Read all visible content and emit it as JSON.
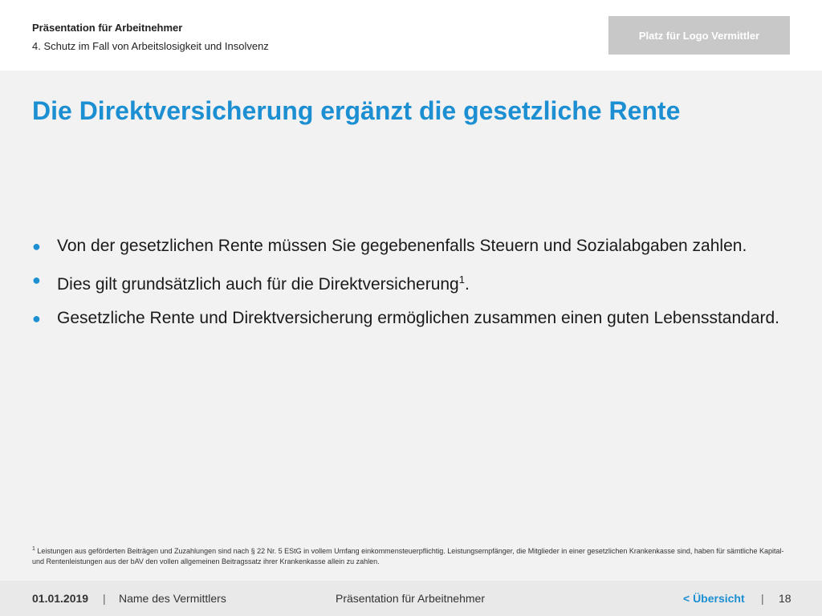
{
  "header": {
    "presentation": "Präsentation für Arbeitnehmer",
    "section": "4. Schutz im Fall von Arbeitslosigkeit und Insolvenz",
    "logo_placeholder": "Platz für Logo Vermittler"
  },
  "slide": {
    "title": "Die Direktversicherung ergänzt die gesetzliche Rente",
    "bullets": [
      {
        "text": "Von der gesetzlichen Rente müssen Sie gegebenenfalls Steuern und Sozialabgaben zahlen."
      },
      {
        "text": "Dies gilt grundsätzlich auch für die Direktversicherung",
        "footnote_ref": "1",
        "tail": "."
      },
      {
        "text": "Gesetzliche Rente und Direktversicherung ermöglichen zusammen einen guten Lebensstandard."
      }
    ],
    "bullet_glyph": "●",
    "footnote": {
      "marker": "1",
      "text": "Leistungen aus geförderten Beiträgen und Zuzahlungen sind nach § 22 Nr. 5 EStG in vollem Umfang einkommensteuerpflichtig. Leistungsempfänger, die Mitglieder in einer gesetzlichen Krankenkasse sind, haben für sämtliche Kapital- und Rentenleistungen aus der bAV den vollen allgemeinen Beitragssatz ihrer Krankenkasse allein zu zahlen."
    }
  },
  "footer": {
    "date": "01.01.2019",
    "separator": "|",
    "broker_name": "Name des Vermittlers",
    "presentation": "Präsentation für Arbeitnehmer",
    "nav_label": "< Übersicht",
    "page_number": "18"
  },
  "colors": {
    "accent": "#1b8fd2",
    "background": "#f2f2f2",
    "logo_box": "#c8c8c8"
  }
}
